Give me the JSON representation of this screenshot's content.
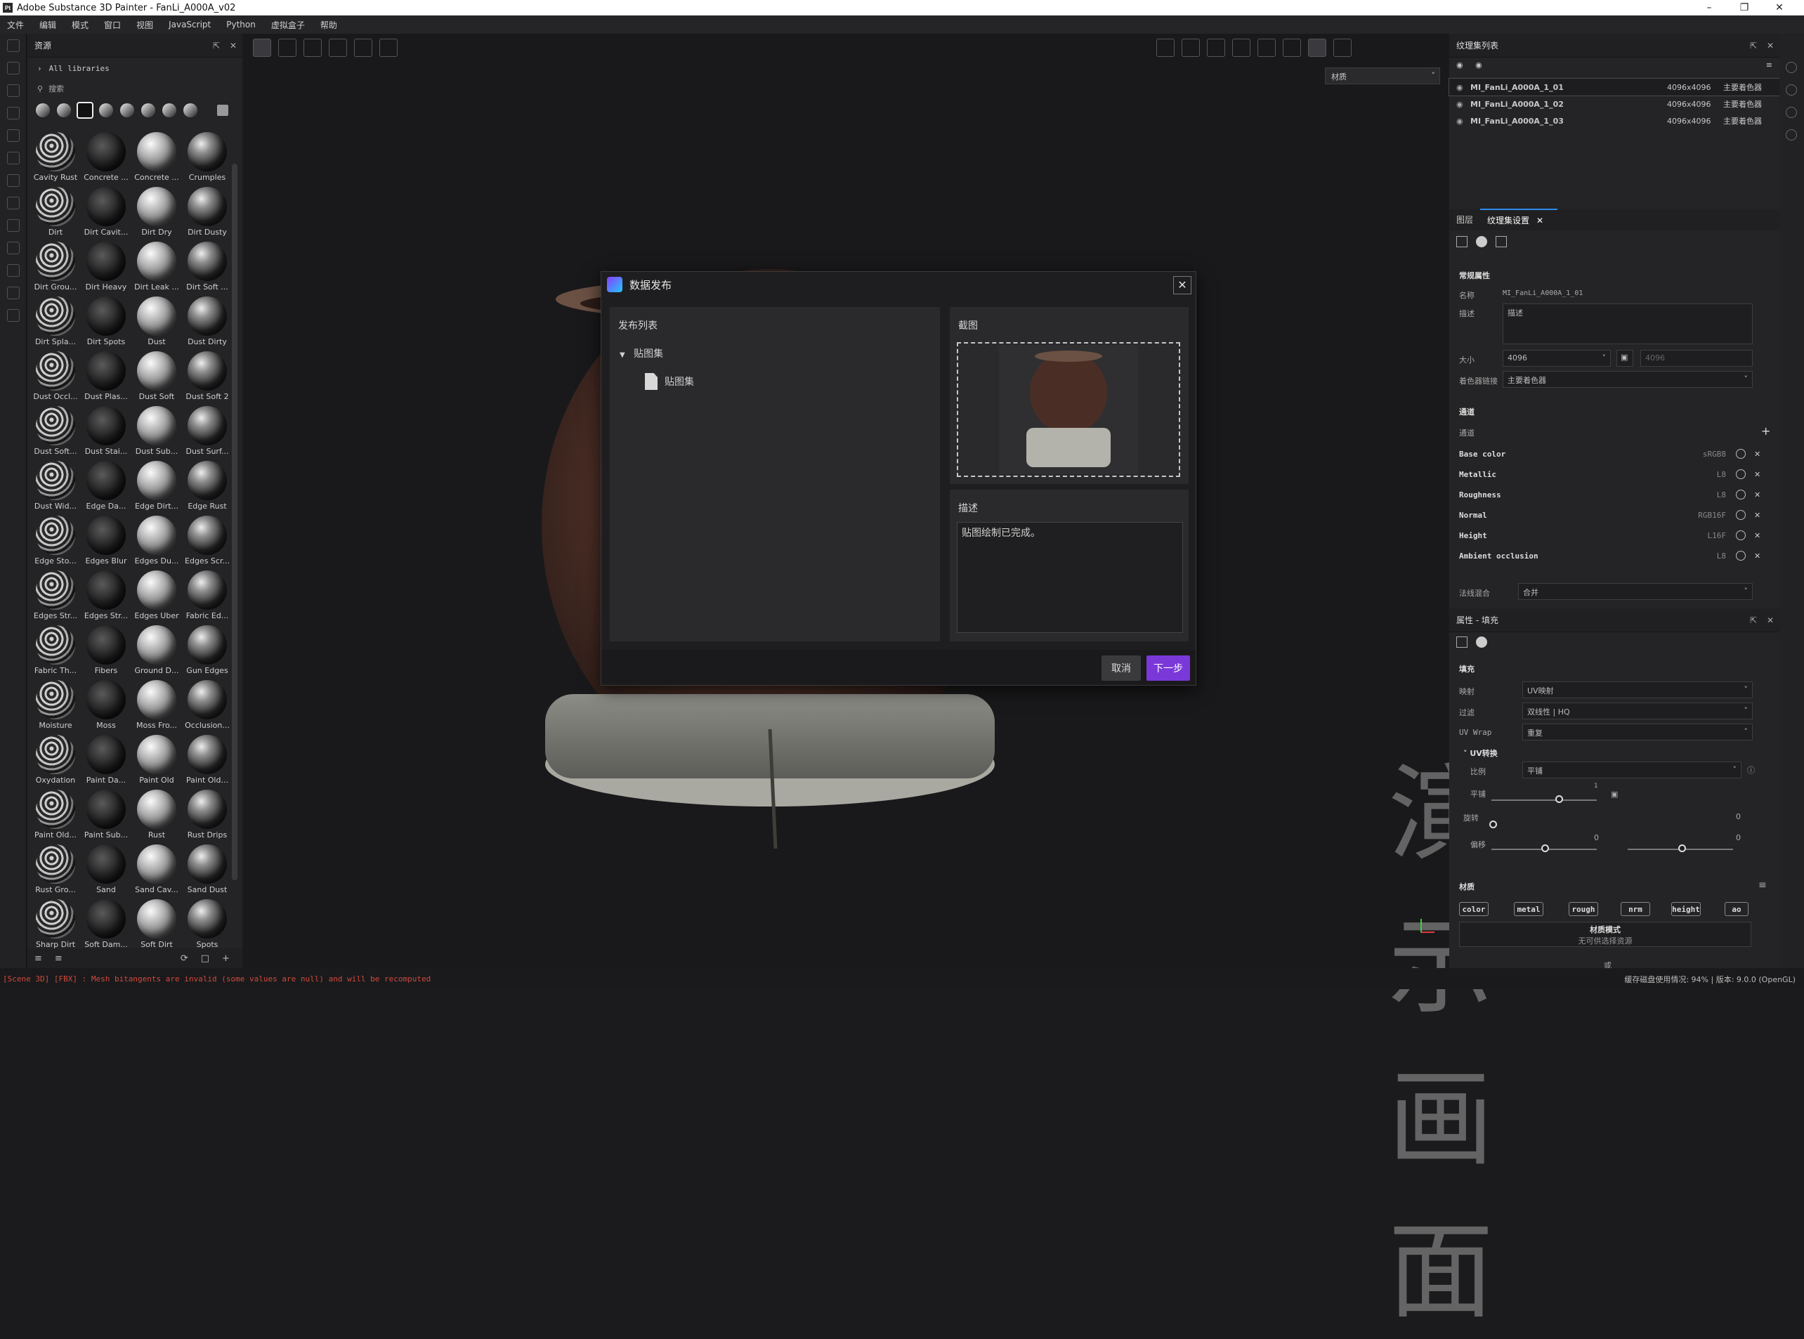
{
  "window": {
    "title": "Adobe Substance 3D Painter - FanLi_A000A_v02",
    "app_icon": "Pt"
  },
  "menu": [
    "文件",
    "编辑",
    "模式",
    "窗口",
    "视图",
    "JavaScript",
    "Python",
    "虚拟盒子",
    "帮助"
  ],
  "assets": {
    "title": "资源",
    "library": "All libraries",
    "search_placeholder": "搜索",
    "items": [
      "Cavity Rust",
      "Concrete ...",
      "Concrete ...",
      "Crumples",
      "Dirt",
      "Dirt Cavit...",
      "Dirt Dry",
      "Dirt Dusty",
      "Dirt Grou...",
      "Dirt Heavy",
      "Dirt Leak ...",
      "Dirt Soft ...",
      "Dirt Spla...",
      "Dirt Spots",
      "Dust",
      "Dust Dirty",
      "Dust Occl...",
      "Dust Plas...",
      "Dust Soft",
      "Dust Soft 2",
      "Dust Soft...",
      "Dust Stai...",
      "Dust Sub...",
      "Dust Surf...",
      "Dust Wid...",
      "Edge Da...",
      "Edge Dirt...",
      "Edge Rust",
      "Edge Sto...",
      "Edges Blur",
      "Edges Du...",
      "Edges Scr...",
      "Edges Str...",
      "Edges Str...",
      "Edges Uber",
      "Fabric Ed...",
      "Fabric Th...",
      "Fibers",
      "Ground D...",
      "Gun Edges",
      "Moisture",
      "Moss",
      "Moss Fro...",
      "Occlusion...",
      "Oxydation",
      "Paint Da...",
      "Paint Old",
      "Paint Old...",
      "Paint Old...",
      "Paint Sub...",
      "Rust",
      "Rust Drips",
      "Rust Gro...",
      "Sand",
      "Sand Cav...",
      "Sand Dust",
      "Sharp Dirt",
      "Soft Dam...",
      "Soft Dirt",
      "Spots"
    ]
  },
  "viewport": {
    "material_select": "材质",
    "watermark": "演示画面"
  },
  "dialog": {
    "title": "数据发布",
    "list_title": "发布列表",
    "group": "贴图集",
    "item": "贴图集",
    "screenshot_title": "截图",
    "desc_title": "描述",
    "desc_value": "贴图绘制已完成。",
    "cancel": "取消",
    "next": "下一步"
  },
  "texture_sets": {
    "title": "纹理集列表",
    "rows": [
      {
        "name": "MI_FanLi_A000A_1_01",
        "res": "4096x4096",
        "shader": "主要着色器"
      },
      {
        "name": "MI_FanLi_A000A_1_02",
        "res": "4096x4096",
        "shader": "主要着色器"
      },
      {
        "name": "MI_FanLi_A000A_1_03",
        "res": "4096x4096",
        "shader": "主要着色器"
      }
    ]
  },
  "settings": {
    "tab_layers": "图层",
    "tab_settings": "纹理集设置",
    "section_general": "常规属性",
    "name_label": "名称",
    "name_value": "MI_FanLi_A000A_1_01",
    "desc_label": "描述",
    "desc_placeholder": "描述",
    "size_label": "大小",
    "size_value": "4096",
    "size_value2": "4096",
    "shader_label": "着色器链接",
    "shader_value": "主要着色器",
    "section_channels": "通道",
    "channels_label": "通道",
    "channels": [
      {
        "name": "Base color",
        "fmt": "sRGB8"
      },
      {
        "name": "Metallic",
        "fmt": "L8"
      },
      {
        "name": "Roughness",
        "fmt": "L8"
      },
      {
        "name": "Normal",
        "fmt": "RGB16F"
      },
      {
        "name": "Height",
        "fmt": "L16F"
      },
      {
        "name": "Ambient occlusion",
        "fmt": "L8"
      }
    ],
    "normal_mix_label": "法线混合",
    "normal_mix_value": "合并"
  },
  "properties": {
    "title": "属性 - 填充",
    "section_fill": "填充",
    "mapping_label": "映射",
    "mapping_value": "UV映射",
    "filter_label": "过滤",
    "filter_value": "双线性 | HQ",
    "wrap_label": "UV Wrap",
    "wrap_value": "重复",
    "uv_transform": "UV转换",
    "ratio_label": "比例",
    "ratio_value": "平铺",
    "tile_label": "平铺",
    "tile_value": "1",
    "rotate_label": "旋转",
    "rotate_value": "0",
    "offset_label": "偏移",
    "offset_value1": "0",
    "offset_value2": "0",
    "section_material": "材质",
    "mat_buttons": [
      "color",
      "metal",
      "rough",
      "nrm",
      "height",
      "ao"
    ],
    "mat_mode": "材质模式",
    "mat_mode_hint": "无可供选择资源",
    "bottom_label": "或"
  },
  "status": {
    "error": "[Scene 3D] [FBX] : Mesh bitangents are invalid (some values are null) and will be recomputed",
    "right": "缓存磁盘使用情况: 94% | 版本: 9.0.0 (OpenGL)"
  }
}
